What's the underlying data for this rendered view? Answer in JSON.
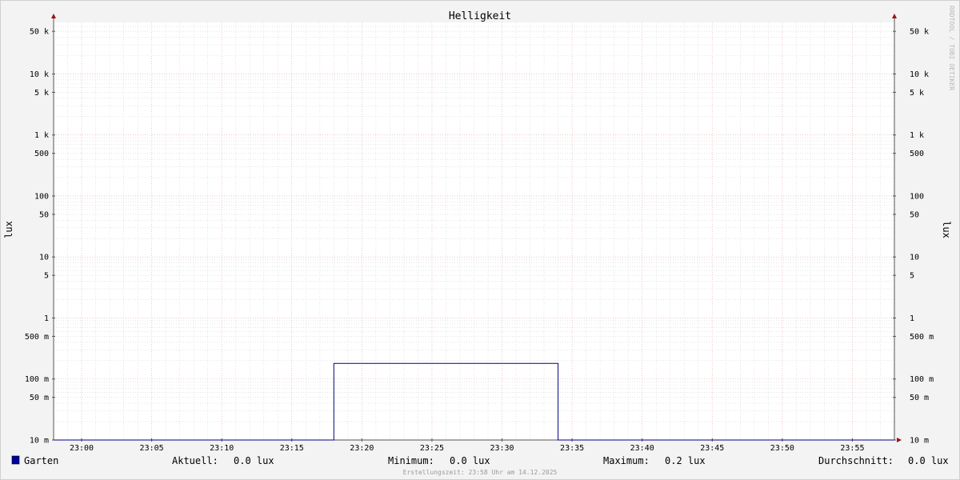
{
  "chart_data": {
    "type": "line",
    "title": "Helligkeit",
    "ylabel": "lux",
    "yscale": "log",
    "ylim": [
      0.01,
      70000
    ],
    "xlim": [
      "22:58",
      "23:58"
    ],
    "y_ticks": [
      {
        "value": 50000,
        "label": "50 k"
      },
      {
        "value": 10000,
        "label": "10 k"
      },
      {
        "value": 5000,
        "label": "5 k"
      },
      {
        "value": 1000,
        "label": "1 k"
      },
      {
        "value": 500,
        "label": "500"
      },
      {
        "value": 100,
        "label": "100"
      },
      {
        "value": 50,
        "label": "50"
      },
      {
        "value": 10,
        "label": "10"
      },
      {
        "value": 5,
        "label": "5"
      },
      {
        "value": 1,
        "label": "1"
      },
      {
        "value": 0.5,
        "label": "500 m"
      },
      {
        "value": 0.1,
        "label": "100 m"
      },
      {
        "value": 0.05,
        "label": "50 m"
      },
      {
        "value": 0.01,
        "label": "10 m"
      }
    ],
    "x_ticks": [
      "23:00",
      "23:05",
      "23:10",
      "23:15",
      "23:20",
      "23:25",
      "23:30",
      "23:35",
      "23:40",
      "23:45",
      "23:50",
      "23:55"
    ],
    "grid": true,
    "legend_position": "bottom",
    "series": [
      {
        "name": "Garten",
        "color": "#000080",
        "swatch_color": "#0000a0",
        "x": [
          "22:58",
          "23:18",
          "23:18",
          "23:34",
          "23:34",
          "23:58"
        ],
        "y": [
          0.01,
          0.01,
          0.18,
          0.18,
          0.01,
          0.01
        ]
      }
    ]
  },
  "legend": {
    "series_name": "Garten",
    "stats": [
      {
        "label": "Aktuell:",
        "value": "0.0 lux"
      },
      {
        "label": "Minimum:",
        "value": "0.0 lux"
      },
      {
        "label": "Maximum:",
        "value": "0.2 lux"
      },
      {
        "label": "Durchschnitt:",
        "value": "0.0 lux"
      }
    ]
  },
  "footer": {
    "text": "Erstellungszeit: 23:58 Uhr am 14.12.2025"
  },
  "watermark": {
    "text": "RRDTOOL / TOBI OETIKER"
  }
}
